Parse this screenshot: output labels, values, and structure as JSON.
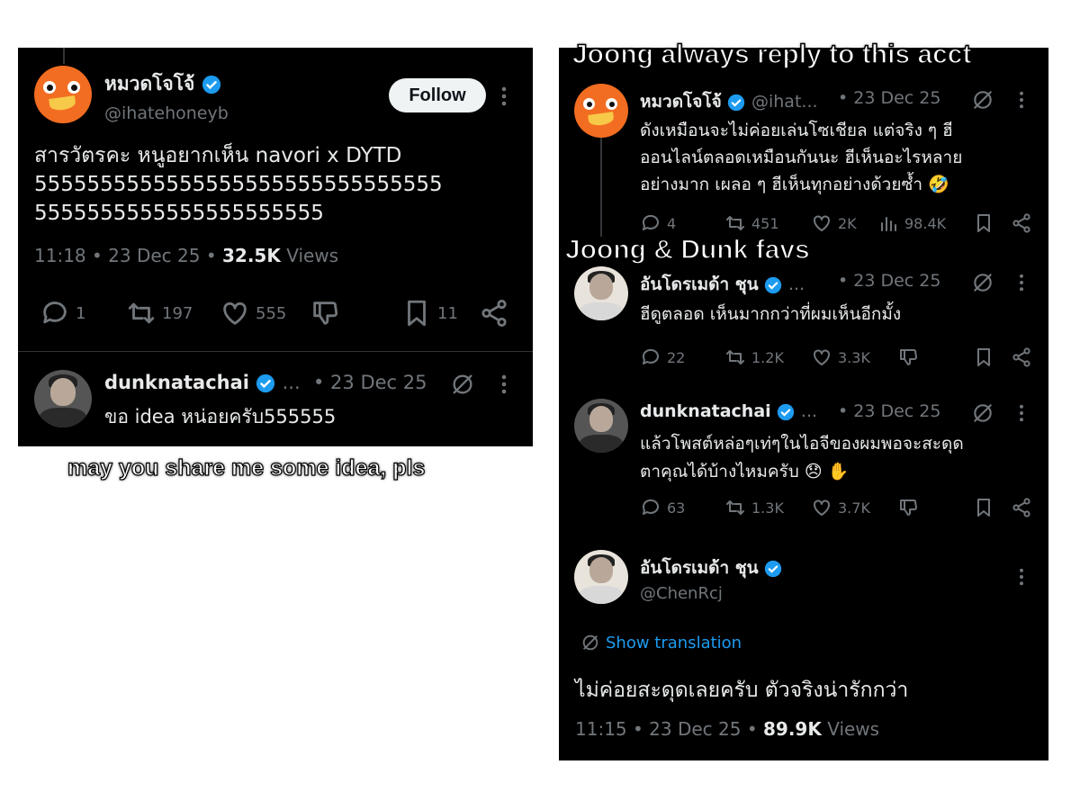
{
  "captions": {
    "top_right": "Joong always reply to this acct",
    "middle_right": "Joong & Dunk favs",
    "bottom_left": "may you share me some idea, pls"
  },
  "left": {
    "main_tweet": {
      "name": "หมวดโจโจ้",
      "handle": "@ihatehoneyb",
      "follow_label": "Follow",
      "text_line1": "สารวัตรคะ หนูอยากเห็น navori x DYTD",
      "text_line2": "5555555555555555555555555555555",
      "text_line3": "5555555555555555555555",
      "time": "11:18",
      "date": "23 Dec 25",
      "views_count": "32.5K",
      "views_label": "Views",
      "replies": "1",
      "retweets": "197",
      "likes": "555",
      "bookmarks": "11"
    },
    "reply": {
      "name": "dunknatachai",
      "ellipsis": "...",
      "date": "• 23 Dec 25",
      "text": "ขอ idea หน่อยครับ555555"
    }
  },
  "right": {
    "tweet1": {
      "name": "หมวดโจโจ้",
      "handle": "@ihat...",
      "date": "• 23 Dec 25",
      "line1": "ดังเหมือนจะไม่ค่อยเล่นโซเชียล แต่จริง ๆ ฮี",
      "line2": "ออนไลน์ตลอดเหมือนกันนะ ฮีเห็นอะไรหลาย",
      "line3": "อย่างมาก เผลอ ๆ ฮีเห็นทุกอย่างด้วยซ้ำ 🤣",
      "replies": "4",
      "retweets": "451",
      "likes": "2K",
      "views": "98.4K"
    },
    "tweet2": {
      "name": "อันโดรเมด้า ชุน",
      "ellipsis": "...",
      "date": "• 23 Dec 25",
      "line1": "ฮีดูตลอด เห็นมากกว่าที่ผมเห็นอีกมั้ง",
      "replies": "22",
      "retweets": "1.2K",
      "likes": "3.3K"
    },
    "tweet3": {
      "name": "dunknatachai",
      "ellipsis": "...",
      "date": "• 23 Dec 25",
      "line1": "แล้วโพสต์หล่อๆเท่ๆในไอจีของผมพอจะสะดุด",
      "line2": "ตาคุณได้บ้างไหมครับ 😞 ✋",
      "replies": "63",
      "retweets": "1.3K",
      "likes": "3.7K"
    },
    "tweet4": {
      "name": "อันโดรเมด้า ชุน",
      "handle": "@ChenRcj",
      "show_translation": "Show translation",
      "text": "ไม่ค่อยสะดุดเลยครับ ตัวจริงน่ารักกว่า",
      "time": "11:15",
      "date": "23 Dec 25",
      "views_count": "89.9K",
      "views_label": "Views"
    }
  },
  "colors": {
    "background": "#000000",
    "text": "#e7e9ea",
    "muted": "#71767b",
    "verified": "#1d9bf0",
    "link": "#1d9bf0",
    "follow_bg": "#eff3f4"
  }
}
